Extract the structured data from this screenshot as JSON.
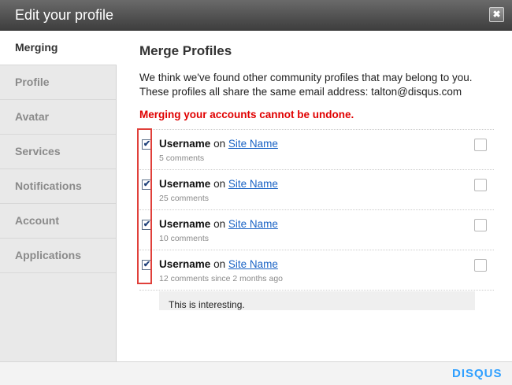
{
  "window": {
    "title": "Edit your profile",
    "close_label": "✖"
  },
  "sidebar": {
    "items": [
      {
        "label": "Merging",
        "active": true
      },
      {
        "label": "Profile",
        "active": false
      },
      {
        "label": "Avatar",
        "active": false
      },
      {
        "label": "Services",
        "active": false
      },
      {
        "label": "Notifications",
        "active": false
      },
      {
        "label": "Account",
        "active": false
      },
      {
        "label": "Applications",
        "active": false
      }
    ]
  },
  "main": {
    "heading": "Merge Profiles",
    "intro": "We think we've found other community profiles that may belong to you. These profiles all share the same email address: talton@disqus.com",
    "warning": "Merging your accounts cannot be undone.",
    "profiles": [
      {
        "username": "Username",
        "on": "on",
        "site": "Site Name",
        "meta": "5 comments",
        "check": "✔",
        "checked": true
      },
      {
        "username": "Username",
        "on": "on",
        "site": "Site Name",
        "meta": "25 comments",
        "check": "✔",
        "checked": true
      },
      {
        "username": "Username",
        "on": "on",
        "site": "Site Name",
        "meta": "10 comments",
        "check": "✔",
        "checked": true
      },
      {
        "username": "Username",
        "on": "on",
        "site": "Site Name",
        "meta": "12 comments since 2 months ago",
        "check": "✔",
        "checked": true
      }
    ],
    "preview_text": "This is interesting."
  },
  "footer": {
    "logo": "DISQUS",
    "logo_color": "#2e9fff"
  },
  "colors": {
    "warning": "#e00000",
    "link": "#1a63c5",
    "highlight": "#e0403a"
  }
}
